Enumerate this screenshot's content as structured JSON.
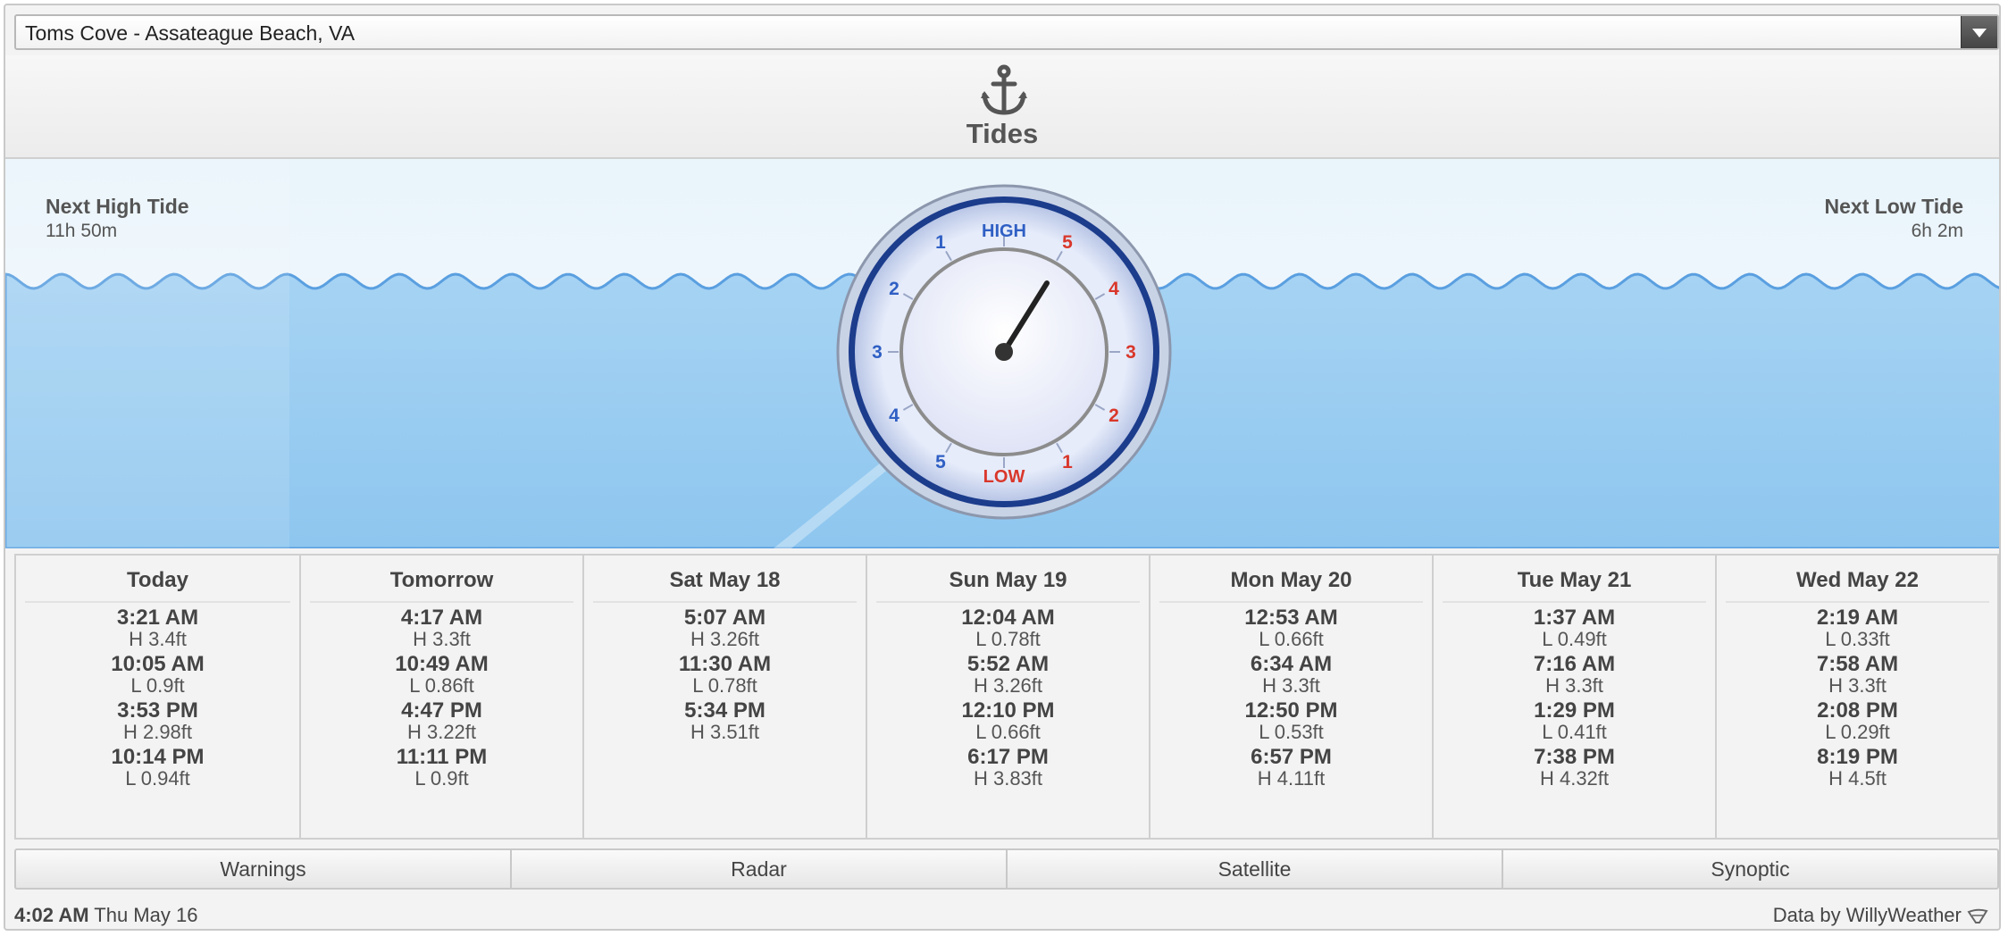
{
  "location": {
    "selected": "Toms Cove - Assateague Beach, VA"
  },
  "header": {
    "title": "Tides"
  },
  "next_high": {
    "label": "Next High Tide",
    "value": "11h 50m"
  },
  "next_low": {
    "label": "Next Low Tide",
    "value": "6h 2m"
  },
  "dial": {
    "high_label": "HIGH",
    "low_label": "LOW",
    "left_numbers": [
      "1",
      "2",
      "3",
      "4",
      "5"
    ],
    "right_numbers": [
      "5",
      "4",
      "3",
      "2",
      "1"
    ],
    "colors": {
      "rising": "#2f5fc4",
      "falling": "#d9372b",
      "rim": "#1c3c8c"
    }
  },
  "days": [
    {
      "name": "Today",
      "tides": [
        {
          "time": "3:21 AM",
          "val": "H 3.4ft"
        },
        {
          "time": "10:05 AM",
          "val": "L 0.9ft"
        },
        {
          "time": "3:53 PM",
          "val": "H 2.98ft"
        },
        {
          "time": "10:14 PM",
          "val": "L 0.94ft"
        }
      ]
    },
    {
      "name": "Tomorrow",
      "tides": [
        {
          "time": "4:17 AM",
          "val": "H 3.3ft"
        },
        {
          "time": "10:49 AM",
          "val": "L 0.86ft"
        },
        {
          "time": "4:47 PM",
          "val": "H 3.22ft"
        },
        {
          "time": "11:11 PM",
          "val": "L 0.9ft"
        }
      ]
    },
    {
      "name": "Sat May 18",
      "tides": [
        {
          "time": "5:07 AM",
          "val": "H 3.26ft"
        },
        {
          "time": "11:30 AM",
          "val": "L 0.78ft"
        },
        {
          "time": "5:34 PM",
          "val": "H 3.51ft"
        }
      ]
    },
    {
      "name": "Sun May 19",
      "tides": [
        {
          "time": "12:04 AM",
          "val": "L 0.78ft"
        },
        {
          "time": "5:52 AM",
          "val": "H 3.26ft"
        },
        {
          "time": "12:10 PM",
          "val": "L 0.66ft"
        },
        {
          "time": "6:17 PM",
          "val": "H 3.83ft"
        }
      ]
    },
    {
      "name": "Mon May 20",
      "tides": [
        {
          "time": "12:53 AM",
          "val": "L 0.66ft"
        },
        {
          "time": "6:34 AM",
          "val": "H 3.3ft"
        },
        {
          "time": "12:50 PM",
          "val": "L 0.53ft"
        },
        {
          "time": "6:57 PM",
          "val": "H 4.11ft"
        }
      ]
    },
    {
      "name": "Tue May 21",
      "tides": [
        {
          "time": "1:37 AM",
          "val": "L 0.49ft"
        },
        {
          "time": "7:16 AM",
          "val": "H 3.3ft"
        },
        {
          "time": "1:29 PM",
          "val": "L 0.41ft"
        },
        {
          "time": "7:38 PM",
          "val": "H 4.32ft"
        }
      ]
    },
    {
      "name": "Wed May 22",
      "tides": [
        {
          "time": "2:19 AM",
          "val": "L 0.33ft"
        },
        {
          "time": "7:58 AM",
          "val": "H 3.3ft"
        },
        {
          "time": "2:08 PM",
          "val": "L 0.29ft"
        },
        {
          "time": "8:19 PM",
          "val": "H 4.5ft"
        }
      ]
    }
  ],
  "tabs": [
    "Warnings",
    "Radar",
    "Satellite",
    "Synoptic"
  ],
  "footer": {
    "time": "4:02 AM",
    "date": "Thu May 16",
    "credit": "Data by WillyWeather"
  }
}
